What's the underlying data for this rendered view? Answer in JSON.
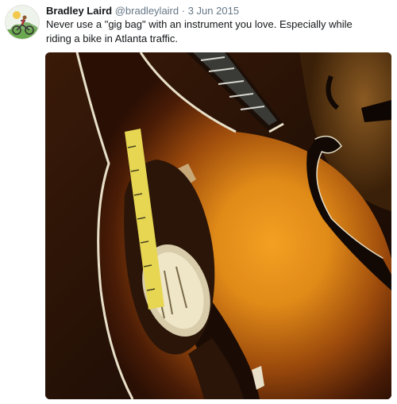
{
  "tweet": {
    "author_name": "Bradley Laird",
    "handle": "@bradleylaird",
    "separator": "·",
    "date": "3 Jun 2015",
    "text": "Never use a \"gig bag\" with an instrument you love. Especially while riding a bike in Atlanta traffic."
  },
  "media": {
    "subject": "broken mandolin photo",
    "colors": {
      "sunburst_center": "#e08a18",
      "sunburst_edge": "#2a0f04",
      "binding": "#e8e0c8",
      "tape": "#e6d652"
    }
  },
  "avatar": {
    "icon": "bicycle-rider-avatar"
  }
}
